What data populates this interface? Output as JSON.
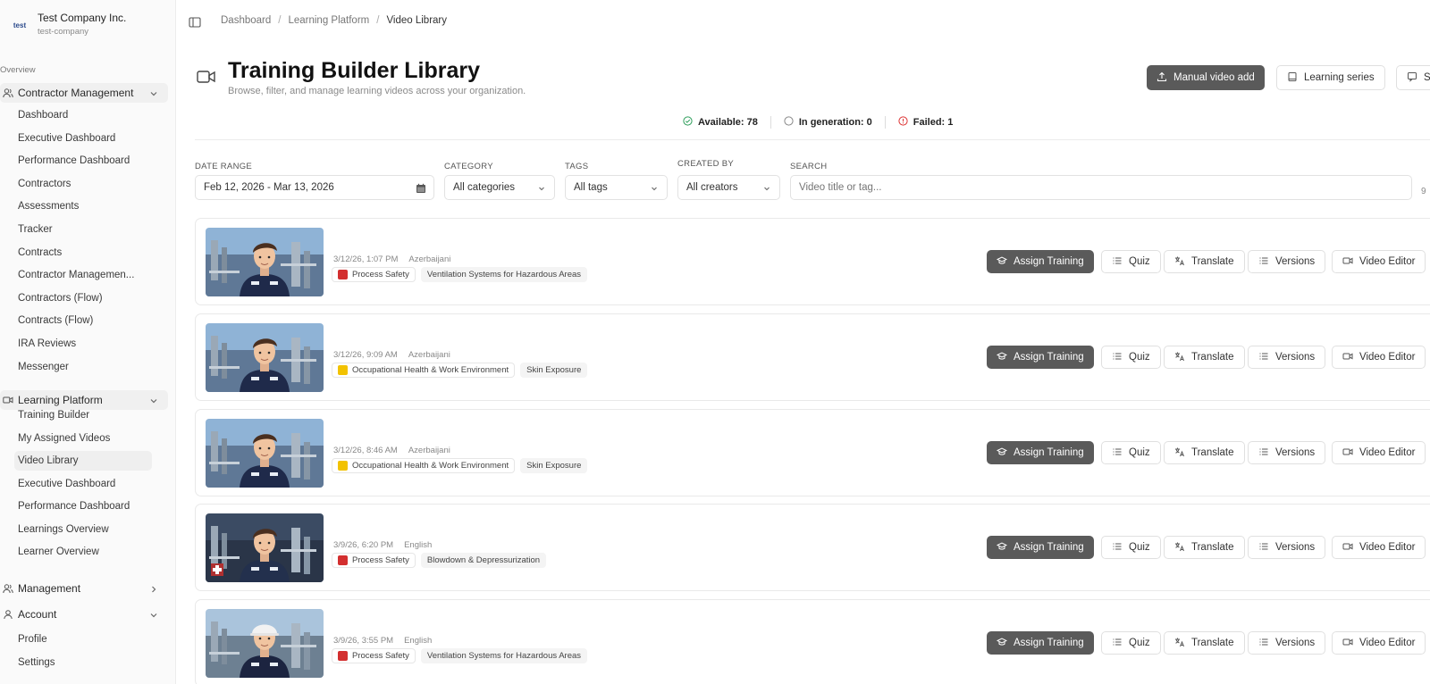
{
  "company": {
    "logo_text": "test",
    "name": "Test Company Inc.",
    "slug": "test-company"
  },
  "sidebar": {
    "section_label": "Overview",
    "groups": {
      "contractor": {
        "label": "Contractor Management",
        "items": [
          "Dashboard",
          "Executive Dashboard",
          "Performance Dashboard",
          "Contractors",
          "Assessments",
          "Tracker",
          "Contracts",
          "Contractor Managemen...",
          "Contractors (Flow)",
          "Contracts (Flow)",
          "IRA Reviews",
          "Messenger"
        ]
      },
      "learning": {
        "label": "Learning Platform",
        "items": [
          "Training Builder",
          "My Assigned Videos",
          "Video Library",
          "Executive Dashboard",
          "Performance Dashboard",
          "Learnings Overview",
          "Learner Overview"
        ]
      },
      "management": {
        "label": "Management"
      },
      "account": {
        "label": "Account",
        "items": [
          "Profile",
          "Settings"
        ]
      }
    }
  },
  "breadcrumb": {
    "items": [
      "Dashboard",
      "Learning Platform",
      "Video Library"
    ]
  },
  "page": {
    "title": "Training Builder Library",
    "subtitle": "Browse, filter, and manage learning videos across your organization."
  },
  "header_buttons": {
    "manual_add": "Manual video add",
    "learning_series": "Learning series",
    "third": "S"
  },
  "status": {
    "available": "Available: 78",
    "in_generation": "In generation: 0",
    "failed": "Failed: 1"
  },
  "filters": {
    "date_range": {
      "label": "DATE RANGE",
      "value": "Feb 12, 2026 - Mar 13, 2026"
    },
    "category": {
      "label": "CATEGORY",
      "value": "All categories"
    },
    "tags": {
      "label": "TAGS",
      "value": "All tags"
    },
    "created_by": {
      "label": "CREATED BY",
      "value": "All creators"
    },
    "search": {
      "label": "SEARCH",
      "placeholder": "Video title or tag..."
    },
    "count_hint": "9"
  },
  "row_actions": {
    "assign": "Assign Training",
    "quiz": "Quiz",
    "translate": "Translate",
    "versions": "Versions",
    "editor": "Video Editor"
  },
  "videos": [
    {
      "date": "3/12/26, 1:07 PM",
      "language": "Azerbaijani",
      "category": "Process Safety",
      "category_color": "#d32f2f",
      "tag": "Ventilation Systems for Hazardous Areas"
    },
    {
      "date": "3/12/26, 9:09 AM",
      "language": "Azerbaijani",
      "category": "Occupational Health & Work Environment",
      "category_color": "#f2c200",
      "tag": "Skin Exposure"
    },
    {
      "date": "3/12/26, 8:46 AM",
      "language": "Azerbaijani",
      "category": "Occupational Health & Work Environment",
      "category_color": "#f2c200",
      "tag": "Skin Exposure"
    },
    {
      "date": "3/9/26, 6:20 PM",
      "language": "English",
      "category": "Process Safety",
      "category_color": "#d32f2f",
      "tag": "Blowdown & Depressurization"
    },
    {
      "date": "3/9/26, 3:55 PM",
      "language": "English",
      "category": "Process Safety",
      "category_color": "#d32f2f",
      "tag": "Ventilation Systems for Hazardous Areas"
    }
  ]
}
